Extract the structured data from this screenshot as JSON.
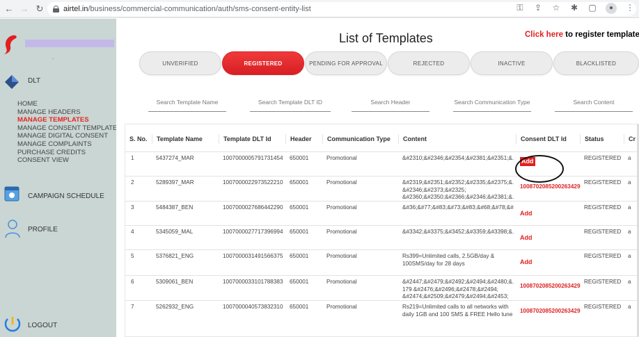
{
  "browser": {
    "url_domain": "airtel.in",
    "url_path": "/business/commercial-communication/auth/sms-consent-entity-list"
  },
  "sidebar": {
    "brand_dot": ".",
    "dlt_label": "DLT",
    "menu": [
      {
        "label": "HOME",
        "active": false
      },
      {
        "label": "MANAGE HEADERS",
        "active": false
      },
      {
        "label": "MANAGE TEMPLATES",
        "active": true
      },
      {
        "label": "MANAGE CONSENT TEMPLATES",
        "active": false
      },
      {
        "label": "MANAGE DIGITAL CONSENT",
        "active": false
      },
      {
        "label": "MANAGE COMPLAINTS",
        "active": false
      },
      {
        "label": "PURCHASE CREDITS",
        "active": false
      },
      {
        "label": "CONSENT VIEW",
        "active": false
      }
    ],
    "campaign_label": "CAMPAIGN SCHEDULE",
    "profile_label": "PROFILE",
    "logout_label": "LOGOUT"
  },
  "page": {
    "title": "List of Templates",
    "register_link_red": "Click here",
    "register_link_rest": " to register template"
  },
  "tabs": [
    {
      "label": "UNVERIFIED",
      "active": false
    },
    {
      "label": "REGISTERED",
      "active": true
    },
    {
      "label": "PENDING FOR APPROVAL",
      "active": false
    },
    {
      "label": "REJECTED",
      "active": false
    },
    {
      "label": "INACTIVE",
      "active": false
    },
    {
      "label": "BLACKLISTED",
      "active": false
    }
  ],
  "filters": [
    {
      "placeholder": "Search Template Name"
    },
    {
      "placeholder": "Search Template DLT ID"
    },
    {
      "placeholder": "Search Header"
    },
    {
      "placeholder": "Search Communication Type"
    },
    {
      "placeholder": "Search Content"
    }
  ],
  "table": {
    "columns": [
      "S. No.",
      "Template Name",
      "Template DLT Id",
      "Header",
      "Communication Type",
      "Content",
      "Consent DLT Id",
      "Status",
      "Cr"
    ],
    "rows": [
      {
        "sno": "1",
        "name": "5437274_MAR",
        "dlt_id": "1007000005791731454",
        "header": "650001",
        "comm_type": "Promotional",
        "content": "&#2310;&#2346;&#2354;&#2381;&#2351;&...",
        "consent": "Add",
        "consent_type": "add-highlight",
        "status": "REGISTERED",
        "cr": "a"
      },
      {
        "sno": "2",
        "name": "5289397_MAR",
        "dlt_id": "1007000022973522210",
        "header": "650001",
        "comm_type": "Promotional",
        "content": "&#2319;&#2351;&#2352;&#2335;&#2375;&... &#2346;&#2373;&#2325; &#2360;&#2350;&#2366;&#2346;&#2381;&...",
        "consent": "1008702085200263429",
        "consent_type": "id",
        "status": "REGISTERED",
        "cr": "a"
      },
      {
        "sno": "3",
        "name": "5484387_BEN",
        "dlt_id": "1007000027686442290",
        "header": "650001",
        "comm_type": "Promotional",
        "content": "&#36;&#77;&#83;&#73;&#83;&#68;&#78;&#...",
        "consent": "Add",
        "consent_type": "add",
        "status": "REGISTERED",
        "cr": "a"
      },
      {
        "sno": "4",
        "name": "5345059_MAL",
        "dlt_id": "1007000027717396994",
        "header": "650001",
        "comm_type": "Promotional",
        "content": "&#3342;&#3375;&#3452;&#3359;&#3398;&...",
        "consent": "Add",
        "consent_type": "add",
        "status": "REGISTERED",
        "cr": "a"
      },
      {
        "sno": "5",
        "name": "5376821_ENG",
        "dlt_id": "1007000031491566375",
        "header": "650001",
        "comm_type": "Promotional",
        "content": "Rs399=Unlimited calls, 2.5GB/day & 100SMS/day for 28 days",
        "consent": "Add",
        "consent_type": "add",
        "status": "REGISTERED",
        "cr": "a"
      },
      {
        "sno": "6",
        "name": "5309061_BEN",
        "dlt_id": "1007000033101788383",
        "header": "650001",
        "comm_type": "Promotional",
        "content": "&#2447;&#2479;&#2492;&#2494;&#2480;&... 179 &#2476;&#2496;&#2478;&#2494; &#2474;&#2509;&#2479;&#2494;&#2453;",
        "consent": "1008702085200263429",
        "consent_type": "id",
        "status": "REGISTERED",
        "cr": "a"
      },
      {
        "sno": "7",
        "name": "5262932_ENG",
        "dlt_id": "1007000040573832310",
        "header": "650001",
        "comm_type": "Promotional",
        "content": "Rs219=Unlimited calls to all networks with daily 1GB and 100 SMS & FREE Hello tune",
        "consent": "1008702085200263429",
        "consent_type": "id",
        "status": "REGISTERED",
        "cr": "a"
      }
    ]
  },
  "colors": {
    "accent_red": "#e02020",
    "sidebar_bg": "#c9d6d3"
  }
}
